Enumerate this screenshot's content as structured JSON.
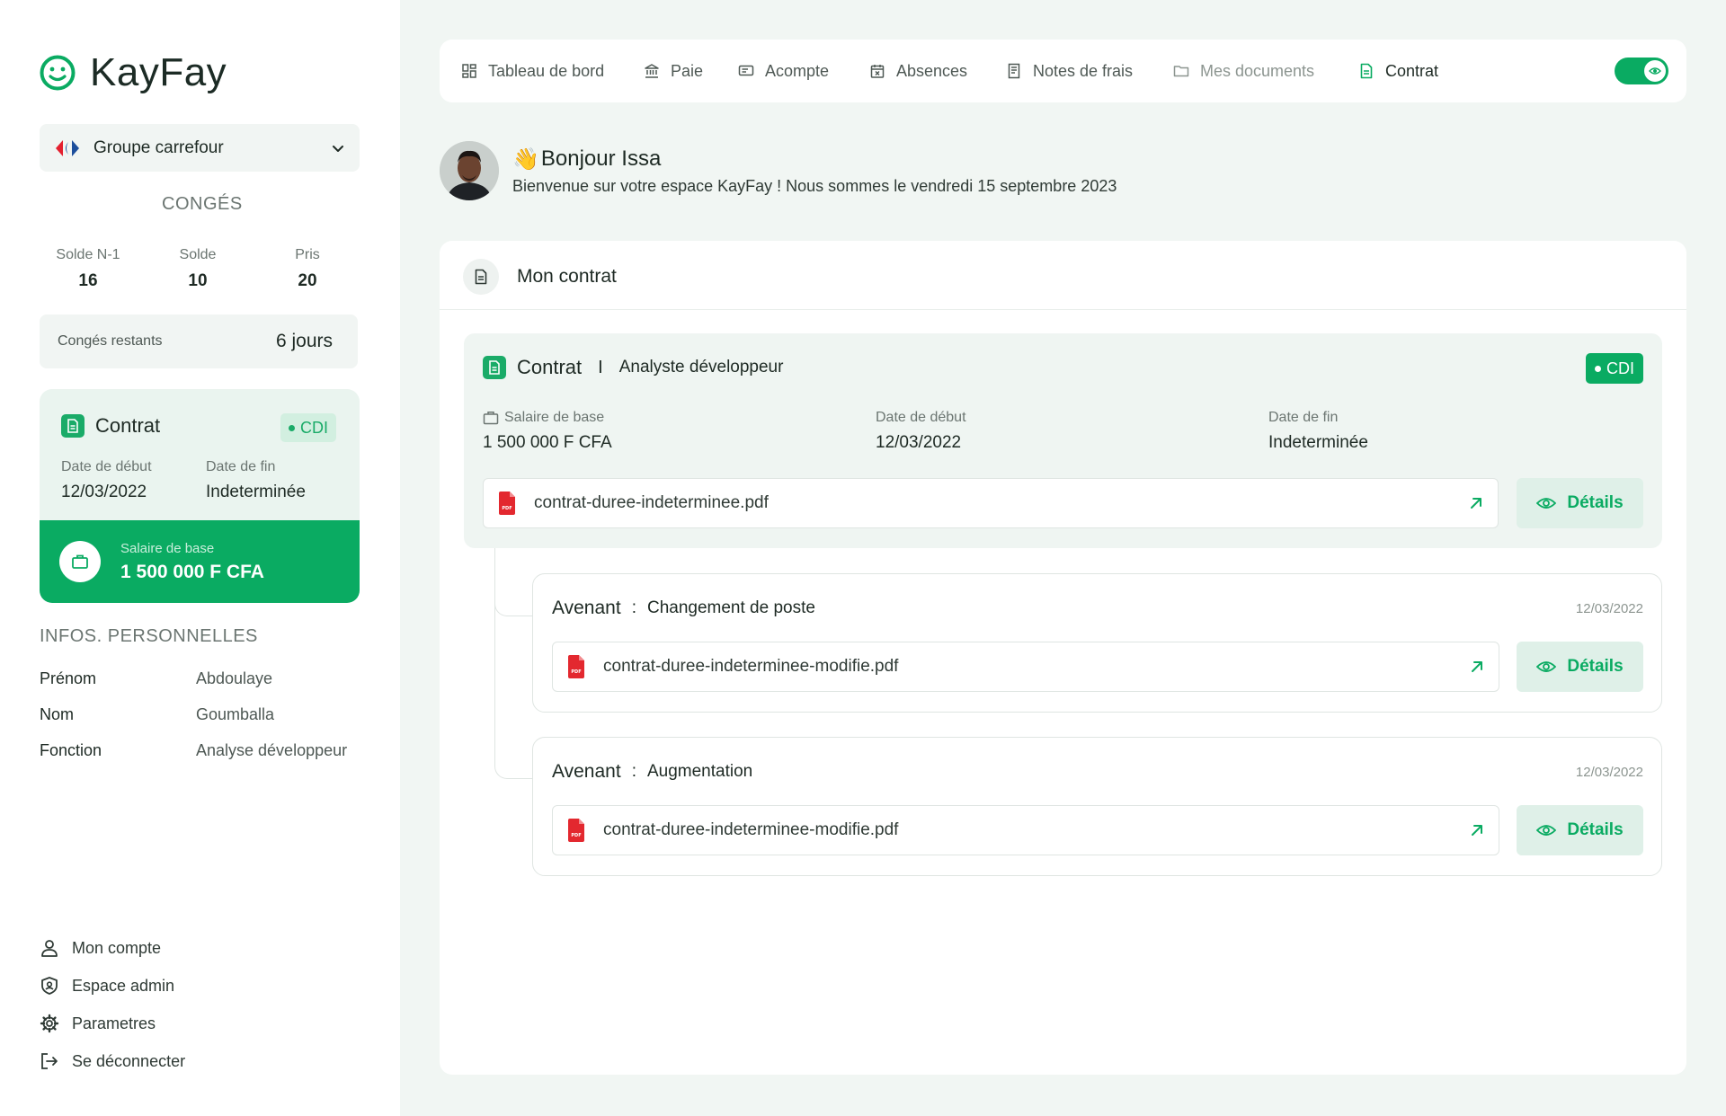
{
  "app": {
    "name": "KayFay",
    "accent": "#0aab62"
  },
  "company": {
    "name": "Groupe carrefour"
  },
  "leave": {
    "title": "CONGÉS",
    "stats": [
      {
        "label": "Solde N-1",
        "value": "16"
      },
      {
        "label": "Solde",
        "value": "10"
      },
      {
        "label": "Pris",
        "value": "20"
      }
    ],
    "remaining_label": "Congés restants",
    "remaining_value": "6 jours"
  },
  "side_contract": {
    "title": "Contrat",
    "badge": "CDI",
    "start_label": "Date de début",
    "start_value": "12/03/2022",
    "end_label": "Date de fin",
    "end_value": "Indeterminée",
    "salary_label": "Salaire de base",
    "salary_value": "1 500 000 F CFA"
  },
  "personal": {
    "title": "INFOS. PERSONNELLES",
    "rows": [
      {
        "key": "Prénom",
        "value": "Abdoulaye"
      },
      {
        "key": "Nom",
        "value": "Goumballa"
      },
      {
        "key": "Fonction",
        "value": "Analyse développeur"
      }
    ]
  },
  "bottom_nav": [
    {
      "label": "Mon compte",
      "icon": "user-icon"
    },
    {
      "label": "Espace admin",
      "icon": "shield-user-icon"
    },
    {
      "label": "Parametres",
      "icon": "gear-icon"
    },
    {
      "label": "Se déconnecter",
      "icon": "logout-icon"
    }
  ],
  "tabs": [
    {
      "label": "Tableau de bord",
      "icon": "dashboard-icon"
    },
    {
      "label": "Paie",
      "icon": "bank-icon"
    },
    {
      "label": "Acompte",
      "icon": "money-icon"
    },
    {
      "label": "Absences",
      "icon": "calendar-x-icon"
    },
    {
      "label": "Notes de frais",
      "icon": "receipt-icon"
    },
    {
      "label": "Mes documents",
      "icon": "folder-icon"
    },
    {
      "label": "Contrat",
      "icon": "document-icon",
      "active": true
    }
  ],
  "greeting": {
    "title": "Bonjour Issa",
    "subtitle": "Bienvenue sur votre espace KayFay ! Nous sommes le vendredi 15 septembre 2023"
  },
  "main": {
    "title": "Mon contrat",
    "contract": {
      "title": "Contrat",
      "separator": "I",
      "role": "Analyste développeur",
      "badge": "CDI",
      "salary_label": "Salaire de base",
      "salary_value": "1 500 000 F CFA",
      "start_label": "Date de début",
      "start_value": "12/03/2022",
      "end_label": "Date de fin",
      "end_value": "Indeterminée",
      "file": "contrat-duree-indeterminee.pdf",
      "details_label": "Détails"
    },
    "avenants": [
      {
        "title": "Avenant",
        "subject": "Changement de poste",
        "date": "12/03/2022",
        "file": "contrat-duree-indeterminee-modifie.pdf",
        "details_label": "Détails"
      },
      {
        "title": "Avenant",
        "subject": "Augmentation",
        "date": "12/03/2022",
        "file": "contrat-duree-indeterminee-modifie.pdf",
        "details_label": "Détails"
      }
    ]
  }
}
